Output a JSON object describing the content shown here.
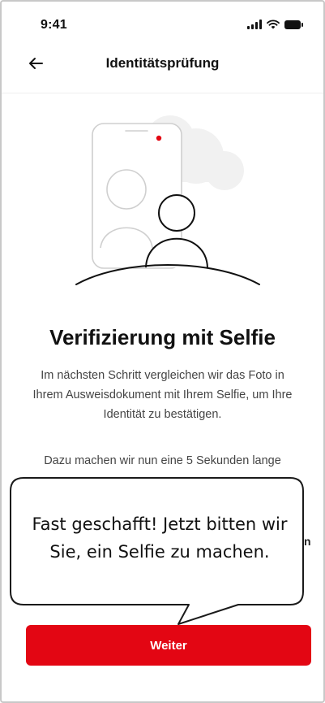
{
  "status_bar": {
    "time": "9:41",
    "icons": [
      "signal-icon",
      "wifi-icon",
      "battery-icon"
    ]
  },
  "nav": {
    "back_icon": "arrow-left-icon",
    "title": "Identitätsprüfung"
  },
  "illustration": {
    "name": "selfie-illustration-icon",
    "accent_color": "#e30613"
  },
  "content": {
    "heading": "Verifizierung mit Selfie",
    "paragraph_1": "Im nächsten Schritt vergleichen wir das Foto in Ihrem Ausweisdokument mit Ihrem Selfie, um Ihre Identität zu bestätigen.",
    "paragraph_2": "Dazu machen wir nun eine 5 Sekunden lange",
    "partially_hidden_char": "n"
  },
  "callout": {
    "text": "Fast geschafft! Jetzt bitten wir Sie, ein Selfie zu machen."
  },
  "actions": {
    "primary_label": "Weiter",
    "primary_color": "#e30613"
  }
}
